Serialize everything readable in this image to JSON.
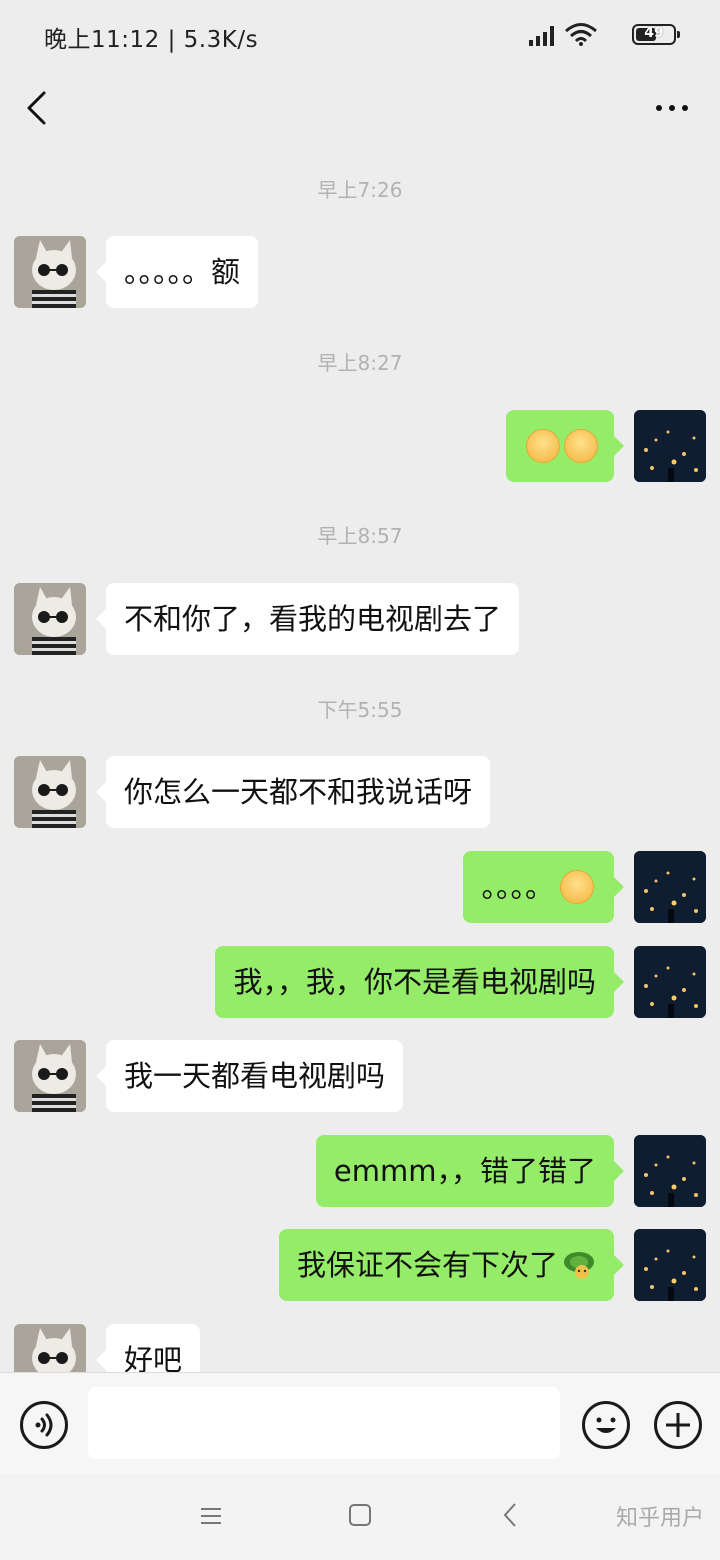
{
  "status_bar": {
    "time": "晚上11:12 | 5.3K/s",
    "battery": "49"
  },
  "nav": {
    "back_icon": "chevron-left-icon",
    "more_icon": "ellipsis-icon"
  },
  "messages": [
    {
      "kind": "time",
      "text": "早上7:26"
    },
    {
      "kind": "in",
      "text": "。。。。。额"
    },
    {
      "kind": "time",
      "text": "早上8:27"
    },
    {
      "kind": "out",
      "text": "",
      "emoji": "relieved-face-emoji x2"
    },
    {
      "kind": "time",
      "text": "早上8:57"
    },
    {
      "kind": "in",
      "text": "不和你了，看我的电视剧去了"
    },
    {
      "kind": "time",
      "text": "下午5:55"
    },
    {
      "kind": "in",
      "text": "你怎么一天都不和我说话呀"
    },
    {
      "kind": "out",
      "text": "。。。。",
      "emoji": "flushed-face-emoji"
    },
    {
      "kind": "out",
      "text": "我，，我，你不是看电视剧吗"
    },
    {
      "kind": "in",
      "text": "我一天都看电视剧吗"
    },
    {
      "kind": "out",
      "text": "emmm，，错了错了"
    },
    {
      "kind": "out",
      "text": "我保证不会有下次了",
      "emoji": "turtle-emoji"
    },
    {
      "kind": "in",
      "text": "好吧"
    }
  ],
  "input_bar": {
    "voice_icon": "voice-icon",
    "placeholder": "",
    "emoji_icon": "smile-icon",
    "plus_icon": "plus-icon"
  },
  "watermark": "知乎用户"
}
